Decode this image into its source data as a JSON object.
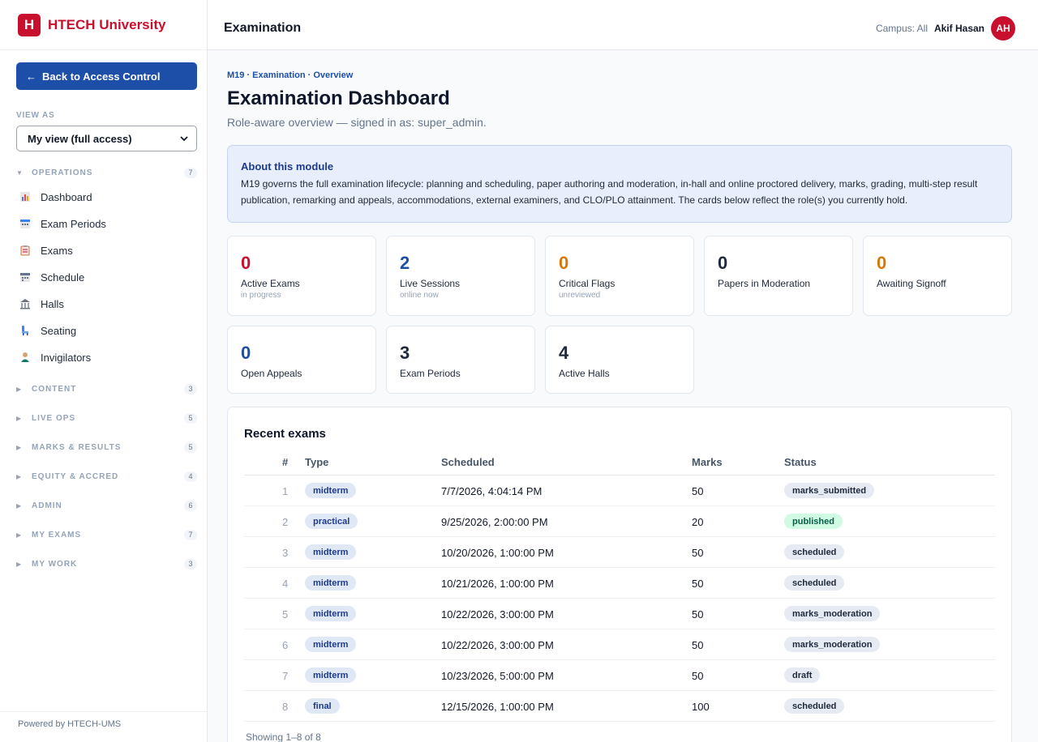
{
  "brand": {
    "logo_letter": "H",
    "name": "HTECH University",
    "color": "#c8102e"
  },
  "sidebar": {
    "back_button": "Back to Access Control",
    "view_as_label": "VIEW AS",
    "view_as_value": "My view (full access)",
    "sections": [
      {
        "name": "OPERATIONS",
        "count": "7",
        "expanded": true,
        "items": [
          {
            "label": "Dashboard",
            "icon": "chart-icon"
          },
          {
            "label": "Exam Periods",
            "icon": "calendar-icon"
          },
          {
            "label": "Exams",
            "icon": "clipboard-icon"
          },
          {
            "label": "Schedule",
            "icon": "calendar-icon"
          },
          {
            "label": "Halls",
            "icon": "building-icon"
          },
          {
            "label": "Seating",
            "icon": "seat-icon"
          },
          {
            "label": "Invigilators",
            "icon": "person-icon"
          }
        ]
      },
      {
        "name": "CONTENT",
        "count": "3",
        "expanded": false
      },
      {
        "name": "LIVE OPS",
        "count": "5",
        "expanded": false
      },
      {
        "name": "MARKS & RESULTS",
        "count": "5",
        "expanded": false
      },
      {
        "name": "EQUITY & ACCRED",
        "count": "4",
        "expanded": false
      },
      {
        "name": "ADMIN",
        "count": "6",
        "expanded": false
      },
      {
        "name": "MY EXAMS",
        "count": "7",
        "expanded": false
      },
      {
        "name": "MY WORK",
        "count": "3",
        "expanded": false
      }
    ],
    "footer": "Powered by HTECH-UMS"
  },
  "header": {
    "title": "Examination",
    "campus": "Campus: All",
    "user_name": "Akif Hasan",
    "avatar_initials": "AH"
  },
  "main": {
    "breadcrumb": "M19 · Examination · Overview",
    "title": "Examination Dashboard",
    "subtitle": "Role-aware overview — signed in as: super_admin.",
    "about": {
      "title": "About this module",
      "text": "M19 governs the full examination lifecycle: planning and scheduling, paper authoring and moderation, in-hall and online proctored delivery, marks, grading, multi-step result publication, remarking and appeals, accommodations, external examiners, and CLO/PLO attainment. The cards below reflect the role(s) you currently hold."
    },
    "stats": [
      {
        "value": "0",
        "label": "Active Exams",
        "sub": "in progress",
        "color": "#c8102e"
      },
      {
        "value": "2",
        "label": "Live Sessions",
        "sub": "online now",
        "color": "#1d4ea8"
      },
      {
        "value": "0",
        "label": "Critical Flags",
        "sub": "unreviewed",
        "color": "#d97706"
      },
      {
        "value": "0",
        "label": "Papers in Moderation",
        "sub": "",
        "color": "#1e293b"
      },
      {
        "value": "0",
        "label": "Awaiting Signoff",
        "sub": "",
        "color": "#d97706"
      },
      {
        "value": "0",
        "label": "Open Appeals",
        "sub": "",
        "color": "#1d4ea8"
      },
      {
        "value": "3",
        "label": "Exam Periods",
        "sub": "",
        "color": "#1e293b"
      },
      {
        "value": "4",
        "label": "Active Halls",
        "sub": "",
        "color": "#1e293b"
      }
    ],
    "recent_exams": {
      "title": "Recent exams",
      "columns": [
        "#",
        "Type",
        "Scheduled",
        "Marks",
        "Status"
      ],
      "rows": [
        {
          "num": "1",
          "type": "midterm",
          "scheduled": "7/7/2026, 4:04:14 PM",
          "marks": "50",
          "status": "marks_submitted"
        },
        {
          "num": "2",
          "type": "practical",
          "scheduled": "9/25/2026, 2:00:00 PM",
          "marks": "20",
          "status": "published"
        },
        {
          "num": "3",
          "type": "midterm",
          "scheduled": "10/20/2026, 1:00:00 PM",
          "marks": "50",
          "status": "scheduled"
        },
        {
          "num": "4",
          "type": "midterm",
          "scheduled": "10/21/2026, 1:00:00 PM",
          "marks": "50",
          "status": "scheduled"
        },
        {
          "num": "5",
          "type": "midterm",
          "scheduled": "10/22/2026, 3:00:00 PM",
          "marks": "50",
          "status": "marks_moderation"
        },
        {
          "num": "6",
          "type": "midterm",
          "scheduled": "10/22/2026, 3:00:00 PM",
          "marks": "50",
          "status": "marks_moderation"
        },
        {
          "num": "7",
          "type": "midterm",
          "scheduled": "10/23/2026, 5:00:00 PM",
          "marks": "50",
          "status": "draft"
        },
        {
          "num": "8",
          "type": "final",
          "scheduled": "12/15/2026, 1:00:00 PM",
          "marks": "100",
          "status": "scheduled"
        }
      ],
      "showing": "Showing 1–8 of 8"
    }
  }
}
